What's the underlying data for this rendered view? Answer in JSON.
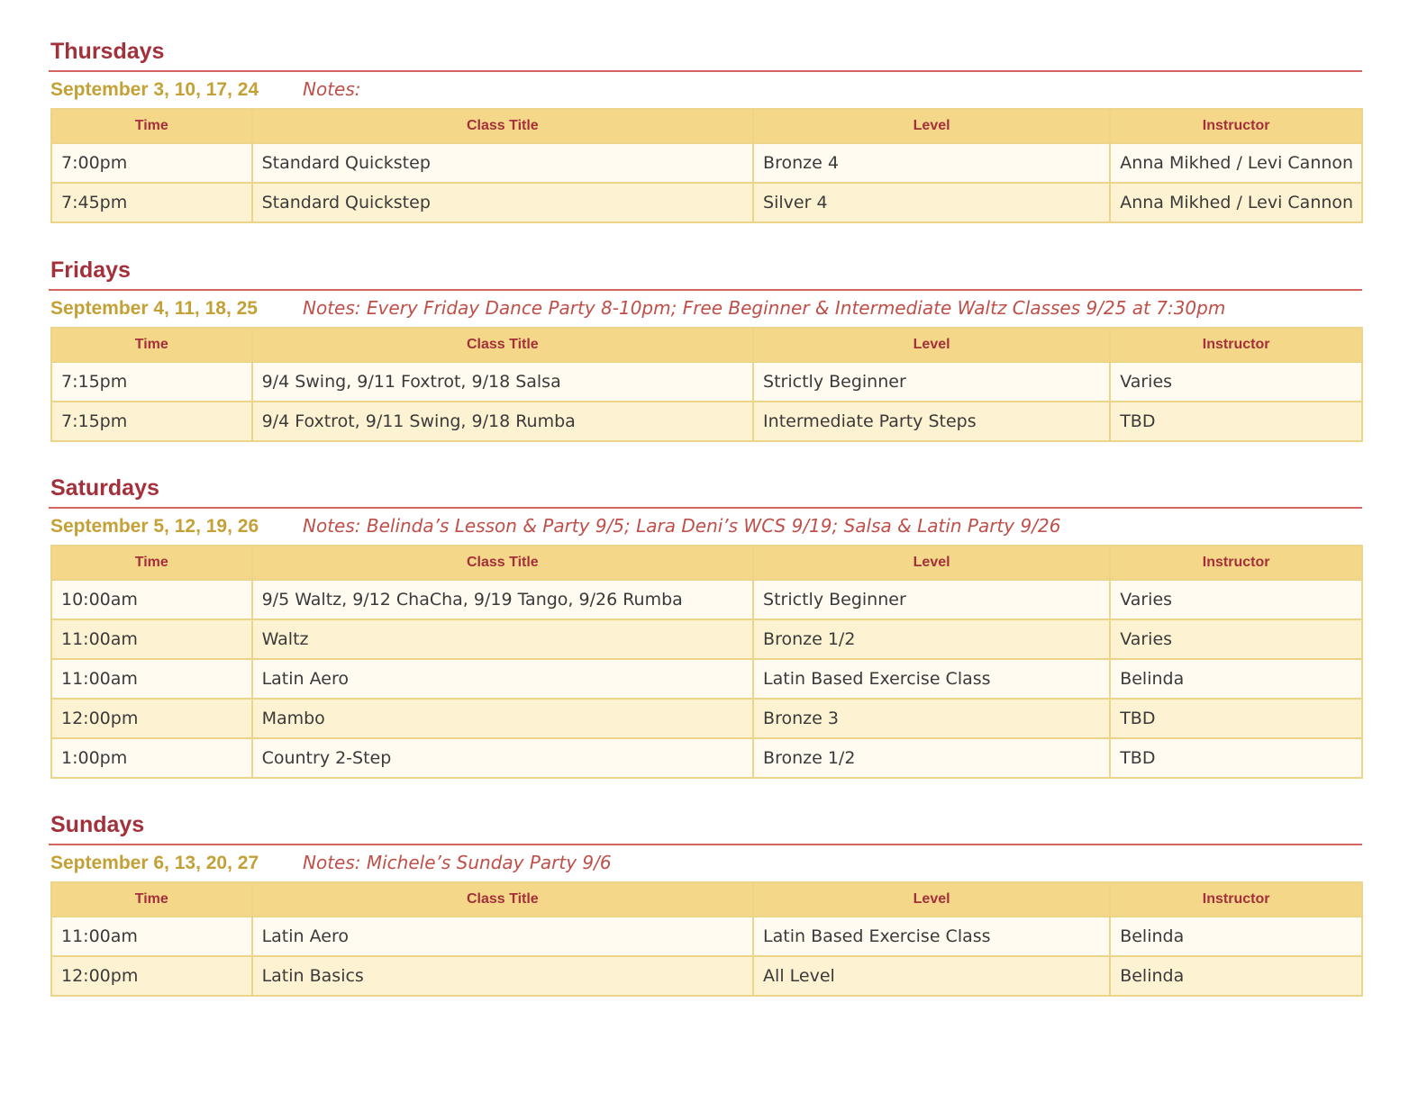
{
  "columns": {
    "time": "Time",
    "title": "Class Title",
    "level": "Level",
    "instructor": "Instructor"
  },
  "sections": [
    {
      "day": "Thursdays",
      "dates": "September 3, 10, 17, 24",
      "notes": "Notes:",
      "rows": [
        {
          "time": "7:00pm",
          "title": "Standard Quickstep",
          "level": "Bronze 4",
          "instructor": "Anna Mikhed / Levi Cannon"
        },
        {
          "time": "7:45pm",
          "title": "Standard Quickstep",
          "level": "Silver 4",
          "instructor": "Anna Mikhed / Levi Cannon"
        }
      ]
    },
    {
      "day": "Fridays",
      "dates": "September 4, 11, 18, 25",
      "notes": "Notes: Every Friday Dance Party 8-10pm;  Free Beginner & Intermediate Waltz Classes  9/25 at 7:30pm",
      "rows": [
        {
          "time": "7:15pm",
          "title": "9/4 Swing,  9/11 Foxtrot,   9/18 Salsa",
          "level": "Strictly Beginner",
          "instructor": "Varies"
        },
        {
          "time": "7:15pm",
          "title": "9/4 Foxtrot,  9/11 Swing,   9/18 Rumba",
          "level": "Intermediate Party Steps",
          "instructor": "TBD"
        }
      ]
    },
    {
      "day": "Saturdays",
      "dates": "September 5, 12, 19, 26",
      "notes": "Notes: Belinda’s Lesson & Party 9/5;   Lara Deni’s WCS 9/19;   Salsa & Latin Party 9/26",
      "rows": [
        {
          "time": "10:00am",
          "title": "9/5 Waltz,  9/12 ChaCha,  9/19 Tango,  9/26 Rumba",
          "level": "Strictly Beginner",
          "instructor": "Varies"
        },
        {
          "time": "11:00am",
          "title": "Waltz",
          "level": "Bronze 1/2",
          "instructor": "Varies"
        },
        {
          "time": "11:00am",
          "title": "Latin Aero",
          "level": "Latin Based Exercise Class",
          "instructor": "Belinda"
        },
        {
          "time": "12:00pm",
          "title": "Mambo",
          "level": "Bronze 3",
          "instructor": "TBD"
        },
        {
          "time": "1:00pm",
          "title": "Country 2-Step",
          "level": "Bronze 1/2",
          "instructor": "TBD"
        }
      ]
    },
    {
      "day": "Sundays",
      "dates": "September 6, 13, 20, 27",
      "notes": "Notes: Michele’s Sunday Party 9/6",
      "rows": [
        {
          "time": "11:00am",
          "title": "Latin Aero",
          "level": "Latin Based Exercise Class",
          "instructor": "Belinda"
        },
        {
          "time": "12:00pm",
          "title": "Latin Basics",
          "level": "All Level",
          "instructor": "Belinda"
        }
      ]
    }
  ],
  "colors": {
    "heading": "#a3303a",
    "rule": "#d5645e",
    "dates": "#c4a136",
    "notes": "#bf4f49",
    "header_fill": "#f5d78a",
    "row_light": "#fffbf0",
    "row_dark": "#fdf3d2",
    "border": "#ecd488"
  }
}
